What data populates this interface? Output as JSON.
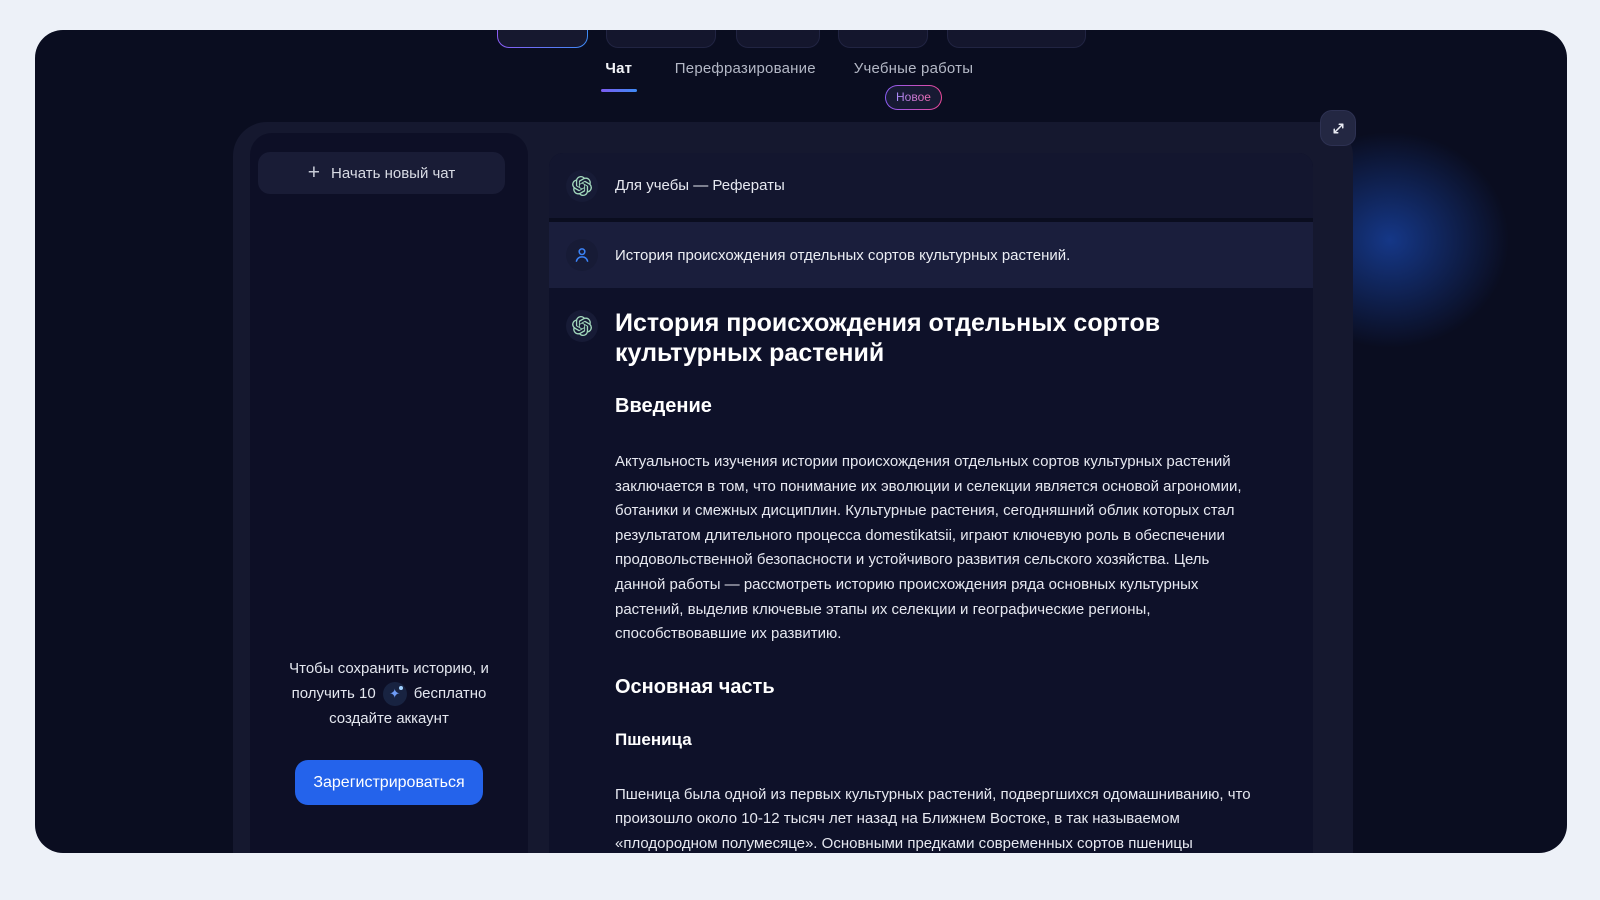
{
  "tabs": {
    "chat": "Чат",
    "paraphrase": "Перефразирование",
    "academic": "Учебные работы",
    "badge": "Новое"
  },
  "sidebar": {
    "new_chat": "Начать новый чат",
    "promo_line1": "Чтобы сохранить историю, и",
    "promo_line2_before": "получить 10",
    "promo_line2_after": "бесплатно",
    "promo_line3": "создайте аккаунт",
    "register": "Зарегистрироваться"
  },
  "chat": {
    "header": "Для учебы — Рефераты",
    "user_message": "История происхождения отдельных сортов культурных растений.",
    "article": {
      "title": "История происхождения отдельных сортов культурных растений",
      "h_intro": "Введение",
      "p_intro": "Актуальность изучения истории происхождения отдельных сортов культурных растений заключается в том, что понимание их эволюции и селекции является основой агрономии, ботаники и смежных дисциплин. Культурные растения, сегодняшний облик которых стал результатом длительного процесса domestikatsii, играют ключевую роль в обеспечении продовольственной безопасности и устойчивого развития сельского хозяйства. Цель данной работы — рассмотреть историю происхождения ряда основных культурных растений, выделив ключевые этапы их селекции и географические регионы, способствовавшие их развитию.",
      "h_main": "Основная часть",
      "h_wheat": "Пшеница",
      "p_wheat": "Пшеница была одной из первых культурных растений, подвергшихся одомашниванию, что произошло около 10-12 тысяч лет назад на Ближнем Востоке, в так называемом «плодородном полумесяце». Основными предками современных сортов пшеницы"
    }
  },
  "icons": {
    "plus": "+",
    "sparkle_star": "✦",
    "openai_logo": "openai-swirl",
    "user": "person-outline",
    "expand": "diagonal-arrows"
  },
  "colors": {
    "accent_blue": "#2463eb",
    "tab_gradient_start": "#7c5cf0",
    "tab_gradient_end": "#3e8bf7",
    "badge_pink": "#ec4899",
    "badge_purple": "#8a5cf5",
    "logo_green": "#a3d9bd",
    "user_icon_blue": "#3b82f6"
  }
}
